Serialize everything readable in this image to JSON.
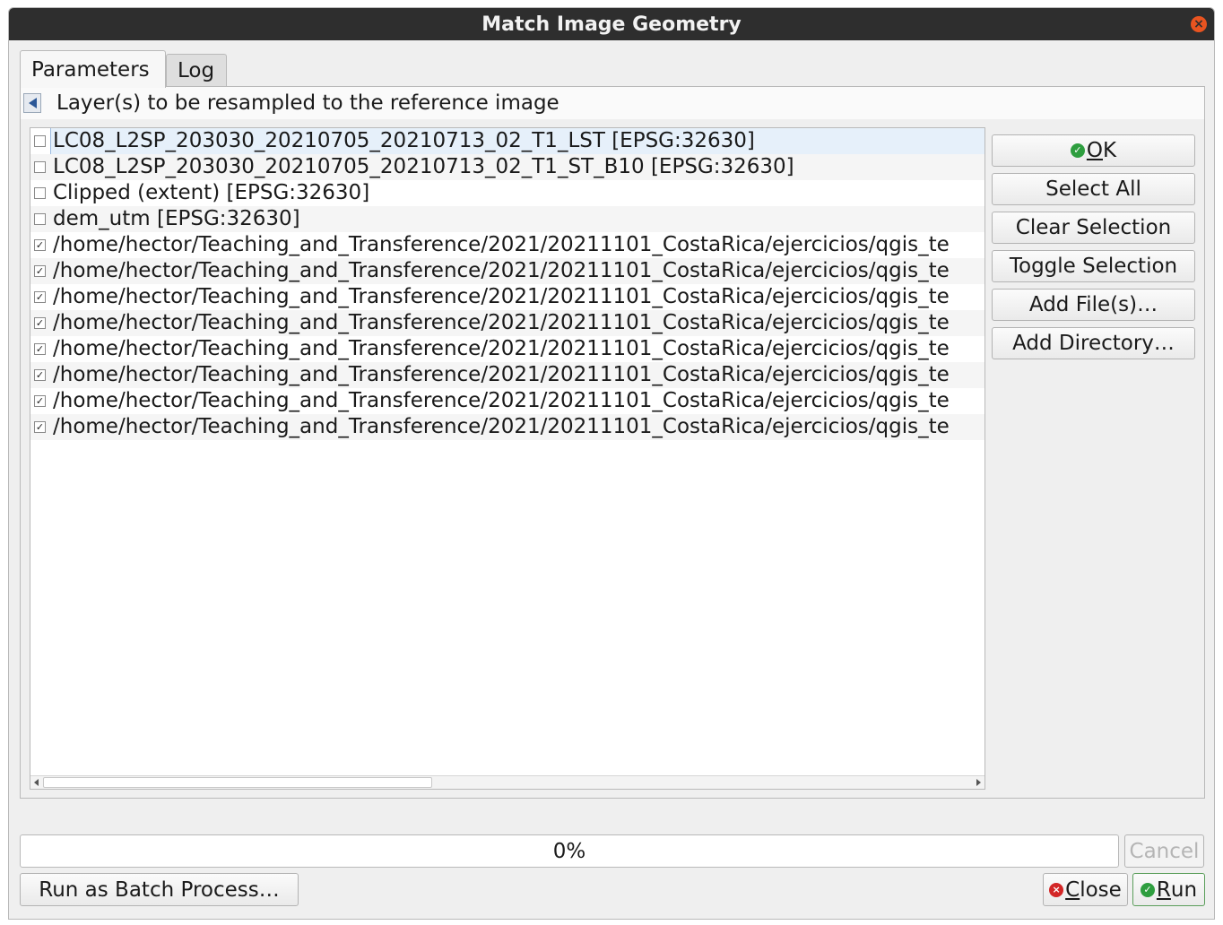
{
  "window": {
    "title": "Match Image Geometry"
  },
  "tabs": [
    {
      "label": "Parameters",
      "active": true
    },
    {
      "label": "Log",
      "active": false
    }
  ],
  "group": {
    "title": "Layer(s) to be resampled to the reference image"
  },
  "layers": [
    {
      "label": "LC08_L2SP_203030_20210705_20210713_02_T1_LST [EPSG:32630]",
      "checked": false,
      "selected": true
    },
    {
      "label": "LC08_L2SP_203030_20210705_20210713_02_T1_ST_B10 [EPSG:32630]",
      "checked": false
    },
    {
      "label": "Clipped (extent) [EPSG:32630]",
      "checked": false
    },
    {
      "label": "dem_utm [EPSG:32630]",
      "checked": false
    },
    {
      "label": "/home/hector/Teaching_and_Transference/2021/20211101_CostaRica/ejercicios/qgis_te",
      "checked": true
    },
    {
      "label": "/home/hector/Teaching_and_Transference/2021/20211101_CostaRica/ejercicios/qgis_te",
      "checked": true
    },
    {
      "label": "/home/hector/Teaching_and_Transference/2021/20211101_CostaRica/ejercicios/qgis_te",
      "checked": true
    },
    {
      "label": "/home/hector/Teaching_and_Transference/2021/20211101_CostaRica/ejercicios/qgis_te",
      "checked": true
    },
    {
      "label": "/home/hector/Teaching_and_Transference/2021/20211101_CostaRica/ejercicios/qgis_te",
      "checked": true
    },
    {
      "label": "/home/hector/Teaching_and_Transference/2021/20211101_CostaRica/ejercicios/qgis_te",
      "checked": true
    },
    {
      "label": "/home/hector/Teaching_and_Transference/2021/20211101_CostaRica/ejercicios/qgis_te",
      "checked": true
    },
    {
      "label": "/home/hector/Teaching_and_Transference/2021/20211101_CostaRica/ejercicios/qgis_te",
      "checked": true
    }
  ],
  "side_buttons": {
    "ok_prefix": "",
    "ok_mnemonic": "O",
    "ok_rest": "K",
    "select_all": "Select All",
    "clear_selection": "Clear Selection",
    "toggle_selection": "Toggle Selection",
    "add_files": "Add File(s)…",
    "add_directory": "Add Directory…"
  },
  "progress": {
    "text": "0%",
    "value": 0
  },
  "bottom": {
    "cancel": "Cancel",
    "batch": "Run as Batch Process…",
    "close_mnemonic": "C",
    "close_rest": "lose",
    "run_mnemonic": "R",
    "run_rest": "un"
  },
  "colors": {
    "titlebar": "#2e2e2e",
    "close_button": "#e95420",
    "ok_icon": "#2e9e3f",
    "cancel_icon": "#d32626",
    "selection": "#e6f0fa"
  },
  "icons": {
    "collapse": "collapse-arrow-icon",
    "ok": "check-circle-icon",
    "close": "cancel-circle-icon",
    "run": "check-circle-icon",
    "window_close": "close-icon"
  }
}
